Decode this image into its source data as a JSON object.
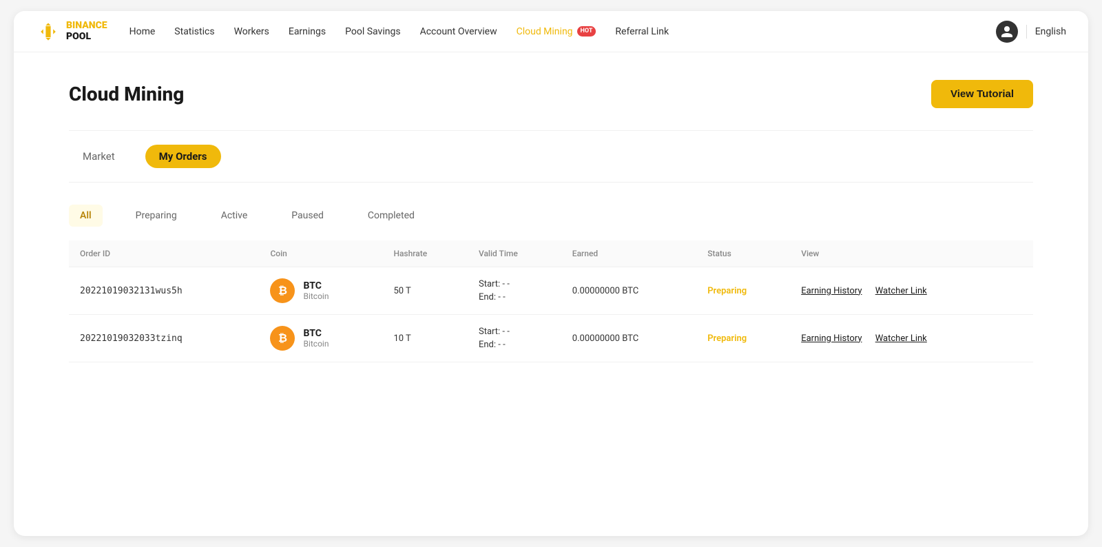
{
  "brand": {
    "name_line1": "BINANCE",
    "name_line2": "POOL"
  },
  "nav": {
    "links": [
      {
        "label": "Home",
        "active": false
      },
      {
        "label": "Statistics",
        "active": false
      },
      {
        "label": "Workers",
        "active": false
      },
      {
        "label": "Earnings",
        "active": false
      },
      {
        "label": "Pool Savings",
        "active": false
      },
      {
        "label": "Account Overview",
        "active": false
      },
      {
        "label": "Cloud Mining",
        "active": true,
        "hot": true
      },
      {
        "label": "Referral Link",
        "active": false
      }
    ],
    "language": "English"
  },
  "page": {
    "title": "Cloud Mining",
    "view_tutorial_btn": "View Tutorial"
  },
  "order_tabs": [
    {
      "label": "Market",
      "active": false
    },
    {
      "label": "My Orders",
      "active": true
    }
  ],
  "status_tabs": [
    {
      "label": "All",
      "active": true
    },
    {
      "label": "Preparing",
      "active": false
    },
    {
      "label": "Active",
      "active": false
    },
    {
      "label": "Paused",
      "active": false
    },
    {
      "label": "Completed",
      "active": false
    }
  ],
  "table": {
    "headers": [
      "Order ID",
      "Coin",
      "Hashrate",
      "Valid Time",
      "Earned",
      "Status",
      "View"
    ],
    "rows": [
      {
        "order_id": "20221019032131wus5h",
        "coin_symbol": "BTC",
        "coin_name": "Bitcoin",
        "hashrate": "50 T",
        "valid_start": "Start: - -",
        "valid_end": "End: - -",
        "earned": "0.00000000 BTC",
        "status": "Preparing",
        "link1": "Earning History",
        "link2": "Watcher Link"
      },
      {
        "order_id": "20221019032033tzinq",
        "coin_symbol": "BTC",
        "coin_name": "Bitcoin",
        "hashrate": "10 T",
        "valid_start": "Start: - -",
        "valid_end": "End: - -",
        "earned": "0.00000000 BTC",
        "status": "Preparing",
        "link1": "Earning History",
        "link2": "Watcher Link"
      }
    ]
  },
  "colors": {
    "accent": "#f0b90b",
    "hot_badge": "#e84142",
    "preparing": "#f0b90b"
  }
}
